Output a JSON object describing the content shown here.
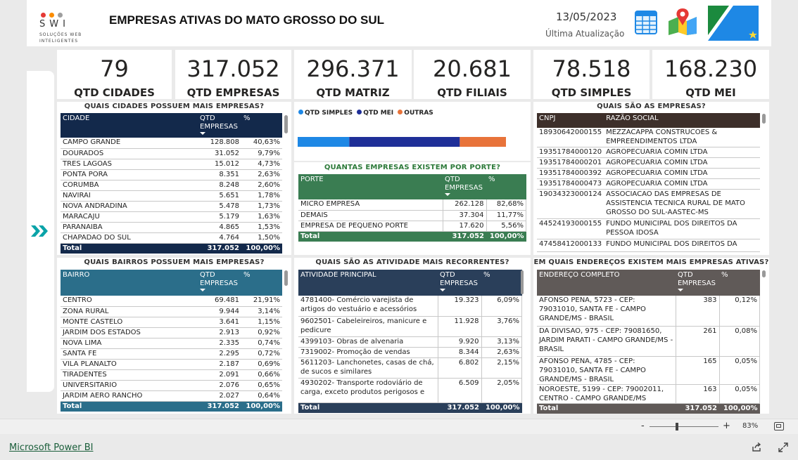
{
  "header": {
    "logo_text": "SWI",
    "logo_sub1": "SOLUÇÕES WEB",
    "logo_sub2": "INTELIGENTES",
    "title": "EMPRESAS ATIVAS DO MATO GROSSO DO SUL",
    "date": "13/05/2023",
    "last_update_label": "Última Atualização"
  },
  "kpis": [
    {
      "value": "79",
      "label": "QTD CIDADES"
    },
    {
      "value": "317.052",
      "label": "QTD EMPRESAS"
    },
    {
      "value": "296.371",
      "label": "QTD MATRIZ"
    },
    {
      "value": "20.681",
      "label": "QTD FILIAIS"
    },
    {
      "value": "78.518",
      "label": "QTD SIMPLES"
    },
    {
      "value": "168.230",
      "label": "QTD MEI"
    }
  ],
  "cities": {
    "title": "QUAIS CIDADES POSSUEM MAIS EMPRESAS?",
    "headers": [
      "CIDADE",
      "QTD EMPRESAS",
      "%"
    ],
    "rows": [
      [
        "CAMPO GRANDE",
        "128.808",
        "40,63%"
      ],
      [
        "DOURADOS",
        "31.052",
        "9,79%"
      ],
      [
        "TRES LAGOAS",
        "15.012",
        "4,73%"
      ],
      [
        "PONTA PORA",
        "8.351",
        "2,63%"
      ],
      [
        "CORUMBA",
        "8.248",
        "2,60%"
      ],
      [
        "NAVIRAI",
        "5.651",
        "1,78%"
      ],
      [
        "NOVA ANDRADINA",
        "5.478",
        "1,73%"
      ],
      [
        "MARACAJU",
        "5.179",
        "1,63%"
      ],
      [
        "PARANAIBA",
        "4.865",
        "1,53%"
      ],
      [
        "CHAPADAO DO SUL",
        "4.764",
        "1,50%"
      ]
    ],
    "total": [
      "Total",
      "317.052",
      "100,00%"
    ]
  },
  "bar_legend": [
    {
      "label": "QTD SIMPLES",
      "color": "#1e88e5"
    },
    {
      "label": "QTD MEI",
      "color": "#1f2f98"
    },
    {
      "label": "OUTRAS",
      "color": "#e8733a"
    }
  ],
  "chart_data": {
    "type": "bar",
    "stacked": true,
    "orientation": "horizontal",
    "series": [
      {
        "name": "QTD SIMPLES",
        "values": [
          78518
        ]
      },
      {
        "name": "QTD MEI",
        "values": [
          168230
        ]
      },
      {
        "name": "OUTRAS",
        "values": [
          70304
        ]
      }
    ],
    "legend": "top-left",
    "colors": [
      "#1e88e5",
      "#1f2f98",
      "#e8733a"
    ]
  },
  "porte": {
    "title": "QUANTAS EMPRESAS EXISTEM POR PORTE?",
    "headers": [
      "PORTE",
      "QTD EMPRESAS",
      "%"
    ],
    "rows": [
      [
        "MICRO EMPRESA",
        "262.128",
        "82,68%"
      ],
      [
        "DEMAIS",
        "37.304",
        "11,77%"
      ],
      [
        "EMPRESA DE PEQUENO PORTE",
        "17.620",
        "5,56%"
      ]
    ],
    "total": [
      "Total",
      "317.052",
      "100,00%"
    ]
  },
  "empresas": {
    "title": "QUAIS SÃO AS EMPRESAS?",
    "headers": [
      "CNPJ",
      "RAZÃO SOCIAL"
    ],
    "rows": [
      [
        "18930642000155",
        "MEZZACAPPA CONSTRUCOES & EMPREENDIMENTOS LTDA"
      ],
      [
        "19351784000120",
        "AGROPECUARIA COMIN LTDA"
      ],
      [
        "19351784000201",
        "AGROPECUARIA COMIN LTDA"
      ],
      [
        "19351784000392",
        "AGROPECUARIA COMIN LTDA"
      ],
      [
        "19351784000473",
        "AGROPECUARIA COMIN LTDA"
      ],
      [
        "19034323000124",
        "ASSOCIACAO DAS EMPRESAS DE ASSISTENCIA TECNICA RURAL DE MATO GROSSO DO SUL-AASTEC-MS"
      ],
      [
        "44524193000155",
        "FUNDO MUNICIPAL DOS DIREITOS DA PESSOA IDOSA"
      ],
      [
        "47458412000133",
        "FUNDO MUNICIPAL DOS DIREITOS DA"
      ]
    ]
  },
  "bairros": {
    "title": "QUAIS BAIRROS POSSUEM MAIS EMPRESAS?",
    "headers": [
      "BAIRRO",
      "QTD EMPRESAS",
      "%"
    ],
    "rows": [
      [
        "CENTRO",
        "69.481",
        "21,91%"
      ],
      [
        "ZONA RURAL",
        "9.944",
        "3,14%"
      ],
      [
        "MONTE CASTELO",
        "3.641",
        "1,15%"
      ],
      [
        "JARDIM DOS ESTADOS",
        "2.913",
        "0,92%"
      ],
      [
        "NOVA LIMA",
        "2.335",
        "0,74%"
      ],
      [
        "SANTA FE",
        "2.295",
        "0,72%"
      ],
      [
        "VILA PLANALTO",
        "2.187",
        "0,69%"
      ],
      [
        "TIRADENTES",
        "2.091",
        "0,66%"
      ],
      [
        "UNIVERSITARIO",
        "2.076",
        "0,65%"
      ],
      [
        "JARDIM AERO RANCHO",
        "2.027",
        "0,64%"
      ]
    ],
    "total": [
      "Total",
      "317.052",
      "100,00%"
    ]
  },
  "atividades": {
    "title": "QUAIS SÃO AS ATIVIDADE MAIS RECORRENTES?",
    "headers": [
      "ATIVIDADE PRINCIPAL",
      "QTD EMPRESAS",
      "%"
    ],
    "rows": [
      [
        "4781400- Comércio varejista de artigos do vestuário e acessórios",
        "19.323",
        "6,09%"
      ],
      [
        "9602501- Cabeleireiros, manicure e pedicure",
        "11.928",
        "3,76%"
      ],
      [
        "4399103- Obras de alvenaria",
        "9.920",
        "3,13%"
      ],
      [
        "7319002- Promoção de vendas",
        "8.344",
        "2,63%"
      ],
      [
        "5611203- Lanchonetes, casas de chá, de sucos e similares",
        "6.802",
        "2,15%"
      ],
      [
        "4930202- Transporte rodoviário de carga, exceto produtos perigosos e",
        "6.509",
        "2,05%"
      ]
    ],
    "total": [
      "Total",
      "317.052",
      "100,00%"
    ]
  },
  "enderecos": {
    "title": "EM QUAIS ENDEREÇOS EXISTEM MAIS EMPRESAS ATIVAS?",
    "headers": [
      "ENDEREÇO COMPLETO",
      "QTD EMPRESAS",
      "%"
    ],
    "rows": [
      [
        "AFONSO PENA, 5723 - CEP: 79031010, SANTA FE - CAMPO GRANDE/MS - BRASIL",
        "383",
        "0,12%"
      ],
      [
        "DA DIVISAO, 975 - CEP: 79081650, JARDIM PARATI - CAMPO GRANDE/MS - BRASIL",
        "261",
        "0,08%"
      ],
      [
        "AFONSO PENA, 4785 - CEP: 79031010, SANTA FE - CAMPO GRANDE/MS - BRASIL",
        "165",
        "0,05%"
      ],
      [
        "NOROESTE, 5199 - CEP: 79002011, CENTRO - CAMPO GRANDE/MS",
        "163",
        "0,05%"
      ]
    ],
    "total": [
      "Total",
      "317.052",
      "100,00%"
    ]
  },
  "footer": {
    "minus": "-",
    "plus": "+",
    "zoom": "83%",
    "brand": "Microsoft Power BI"
  }
}
